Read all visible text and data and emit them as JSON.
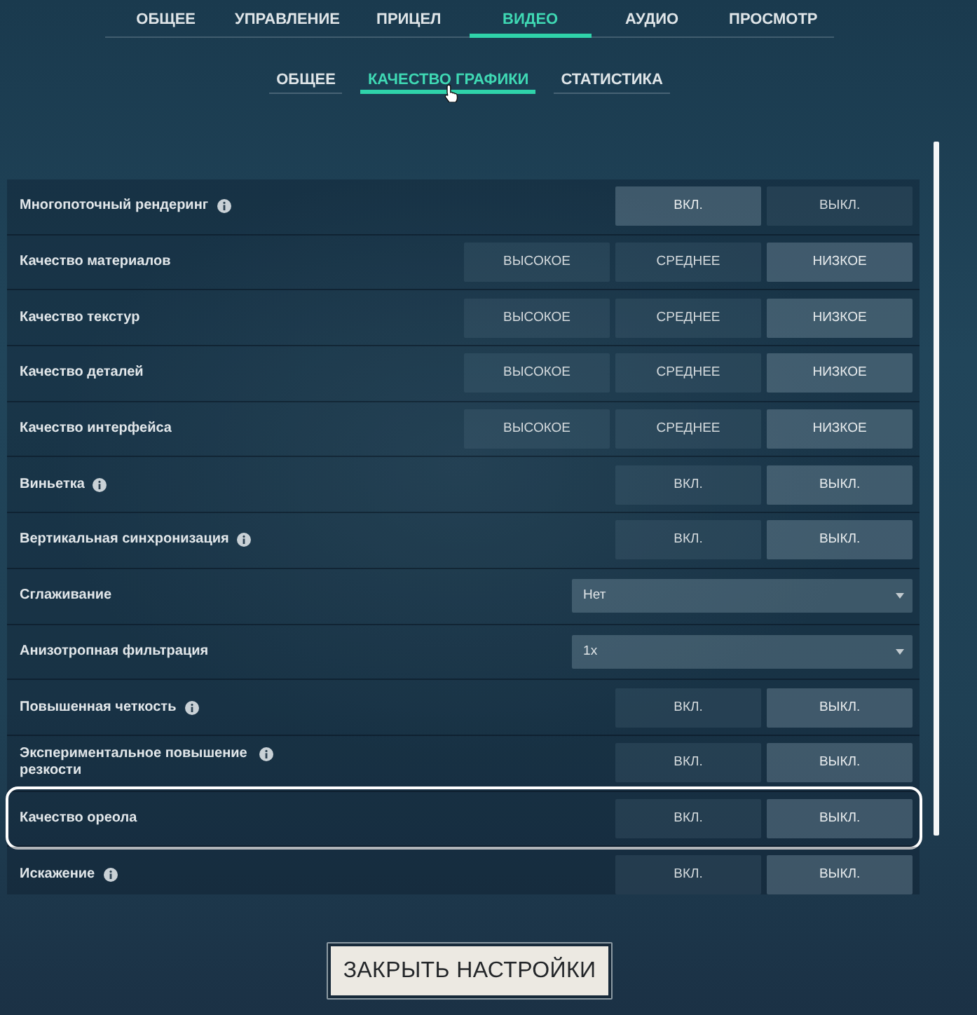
{
  "main_tabs": [
    {
      "label": "ОБЩЕЕ",
      "selected": false
    },
    {
      "label": "УПРАВЛЕНИЕ",
      "selected": false
    },
    {
      "label": "ПРИЦЕЛ",
      "selected": false
    },
    {
      "label": "ВИДЕО",
      "selected": true
    },
    {
      "label": "АУДИО",
      "selected": false
    },
    {
      "label": "ПРОСМОТР",
      "selected": false
    }
  ],
  "sub_tabs": [
    {
      "label": "ОБЩЕЕ",
      "selected": false,
      "hovered": false
    },
    {
      "label": "КАЧЕСТВО ГРАФИКИ",
      "selected": true,
      "hovered": true
    },
    {
      "label": "СТАТИСТИКА",
      "selected": false,
      "hovered": false
    }
  ],
  "settings": [
    {
      "kind": "options",
      "label": "Многопоточный рендеринг",
      "info": true,
      "highlighted": false,
      "options": [
        {
          "label": "ВКЛ.",
          "selected": true
        },
        {
          "label": "ВЫКЛ.",
          "selected": false
        }
      ]
    },
    {
      "kind": "options",
      "label": "Качество материалов",
      "info": false,
      "highlighted": false,
      "options": [
        {
          "label": "ВЫСОКОЕ",
          "selected": false
        },
        {
          "label": "СРЕДНЕЕ",
          "selected": false
        },
        {
          "label": "НИЗКОЕ",
          "selected": true
        }
      ]
    },
    {
      "kind": "options",
      "label": "Качество текстур",
      "info": false,
      "highlighted": false,
      "options": [
        {
          "label": "ВЫСОКОЕ",
          "selected": false
        },
        {
          "label": "СРЕДНЕЕ",
          "selected": false
        },
        {
          "label": "НИЗКОЕ",
          "selected": true
        }
      ]
    },
    {
      "kind": "options",
      "label": "Качество деталей",
      "info": false,
      "highlighted": false,
      "options": [
        {
          "label": "ВЫСОКОЕ",
          "selected": false
        },
        {
          "label": "СРЕДНЕЕ",
          "selected": false
        },
        {
          "label": "НИЗКОЕ",
          "selected": true
        }
      ]
    },
    {
      "kind": "options",
      "label": "Качество интерфейса",
      "info": false,
      "highlighted": false,
      "options": [
        {
          "label": "ВЫСОКОЕ",
          "selected": false
        },
        {
          "label": "СРЕДНЕЕ",
          "selected": false
        },
        {
          "label": "НИЗКОЕ",
          "selected": true
        }
      ]
    },
    {
      "kind": "options",
      "label": "Виньетка",
      "info": true,
      "highlighted": false,
      "options": [
        {
          "label": "ВКЛ.",
          "selected": false
        },
        {
          "label": "ВЫКЛ.",
          "selected": true
        }
      ]
    },
    {
      "kind": "options",
      "label": "Вертикальная синхронизация",
      "info": true,
      "highlighted": false,
      "options": [
        {
          "label": "ВКЛ.",
          "selected": false
        },
        {
          "label": "ВЫКЛ.",
          "selected": true
        }
      ]
    },
    {
      "kind": "dropdown",
      "label": "Сглаживание",
      "info": false,
      "highlighted": false,
      "value": "Нет"
    },
    {
      "kind": "dropdown",
      "label": "Анизотропная фильтрация",
      "info": false,
      "highlighted": false,
      "value": "1x"
    },
    {
      "kind": "options",
      "label": "Повышенная четкость",
      "info": true,
      "highlighted": false,
      "options": [
        {
          "label": "ВКЛ.",
          "selected": false
        },
        {
          "label": "ВЫКЛ.",
          "selected": true
        }
      ]
    },
    {
      "kind": "options",
      "label": "Экспериментальное повышение резкости",
      "info": true,
      "highlighted": false,
      "options": [
        {
          "label": "ВКЛ.",
          "selected": false
        },
        {
          "label": "ВЫКЛ.",
          "selected": true
        }
      ]
    },
    {
      "kind": "options",
      "label": "Качество ореола",
      "info": false,
      "highlighted": true,
      "options": [
        {
          "label": "ВКЛ.",
          "selected": false
        },
        {
          "label": "ВЫКЛ.",
          "selected": true
        }
      ]
    },
    {
      "kind": "options",
      "label": "Искажение",
      "info": true,
      "highlighted": false,
      "options": [
        {
          "label": "ВКЛ.",
          "selected": false
        },
        {
          "label": "ВЫКЛ.",
          "selected": true
        }
      ]
    }
  ],
  "close_button": "ЗАКРЫТЬ НАСТРОЙКИ"
}
